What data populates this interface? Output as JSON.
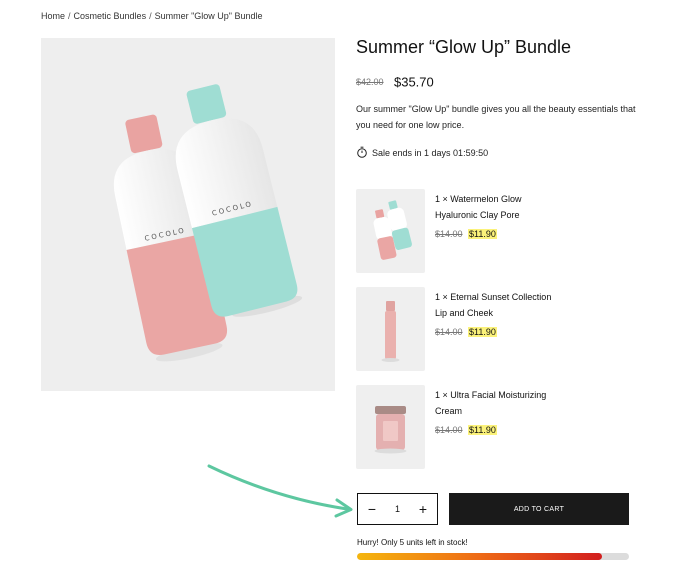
{
  "breadcrumb": {
    "items": [
      "Home",
      "Cosmetic Bundles",
      "Summer \"Glow Up\" Bundle"
    ],
    "separator": "/"
  },
  "product": {
    "title": "Summer “Glow Up” Bundle",
    "old_price": "$42.00",
    "price": "$35.70",
    "description": "Our summer \"Glow Up\" bundle gives you all the beauty essentials that you need for one low price.",
    "sale_text": "Sale ends in 1 days 01:59:50",
    "image_icon": "pink-and-teal-bottles",
    "brand_on_bottle": "COCOLO"
  },
  "bundle_items": [
    {
      "name": "1 × Watermelon Glow Hyaluronic Clay Pore",
      "old_price": "$14.00",
      "price": "$11.90",
      "thumb_icon": "bottles-thumb"
    },
    {
      "name": "1 × Eternal Sunset Collection Lip and Cheek",
      "old_price": "$14.00",
      "price": "$11.90",
      "thumb_icon": "pink-tube-thumb"
    },
    {
      "name": "1 × Ultra Facial Moisturizing Cream",
      "old_price": "$14.00",
      "price": "$11.90",
      "thumb_icon": "pink-jar-thumb"
    }
  ],
  "quantity": {
    "minus": "−",
    "value": "1",
    "plus": "+"
  },
  "cart": {
    "label": "ADD TO CART"
  },
  "stock": {
    "text": "Hurry! Only 5 units left in stock!",
    "level": 0.9
  },
  "colors": {
    "pink": "#eaa6a4",
    "teal": "#9fddd3",
    "highlight": "#fbf27a",
    "annotation_arrow": "#5dc7a0",
    "button": "#1a1a1a"
  }
}
